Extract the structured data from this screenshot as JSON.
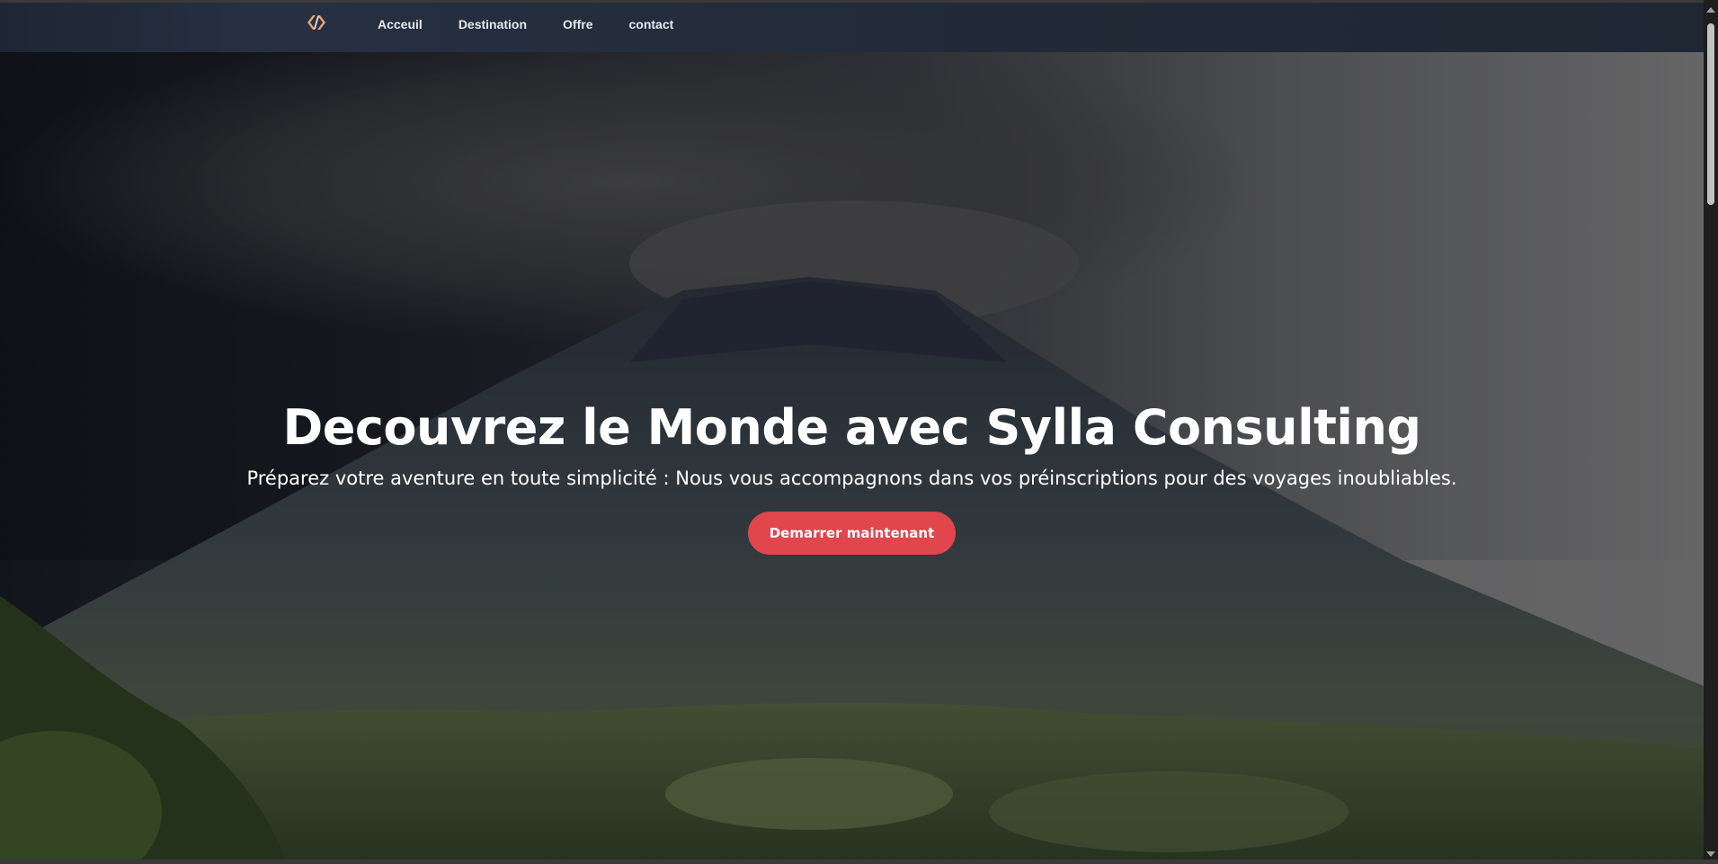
{
  "nav": {
    "logo_icon": "code-bracket-logo-icon",
    "links": [
      "Acceuil",
      "Destination",
      "Offre",
      "contact"
    ]
  },
  "hero": {
    "title": "Decouvrez le Monde avec Sylla Consulting",
    "subtitle": "Préparez votre aventure en toute simplicité : Nous vous accompagnons dans vos préinscriptions pour des voyages inoubliables.",
    "cta_label": "Demarrer maintenant",
    "background": "volcano-mountain-image"
  },
  "colors": {
    "accent": "#e0464c",
    "navbar": "#222a37",
    "text": "#ffffff",
    "logo": "#f0a070"
  }
}
